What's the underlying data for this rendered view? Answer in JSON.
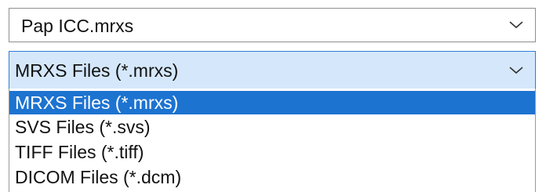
{
  "filename_combo": {
    "value": "Pap ICC.mrxs",
    "icon": "chevron-down-icon"
  },
  "filetype_select": {
    "value": "MRXS Files (*.mrxs)",
    "icon": "chevron-down-icon"
  },
  "dropdown": {
    "options": [
      {
        "label": "MRXS Files (*.mrxs)",
        "selected": true
      },
      {
        "label": "SVS Files (*.svs)",
        "selected": false
      },
      {
        "label": "TIFF Files (*.tiff)",
        "selected": false
      },
      {
        "label": "DICOM Files (*.dcm)",
        "selected": false
      }
    ]
  },
  "colors": {
    "highlight": "#1d73d0",
    "select_background": "#d5e8fb",
    "select_border": "#2f7bd8"
  }
}
